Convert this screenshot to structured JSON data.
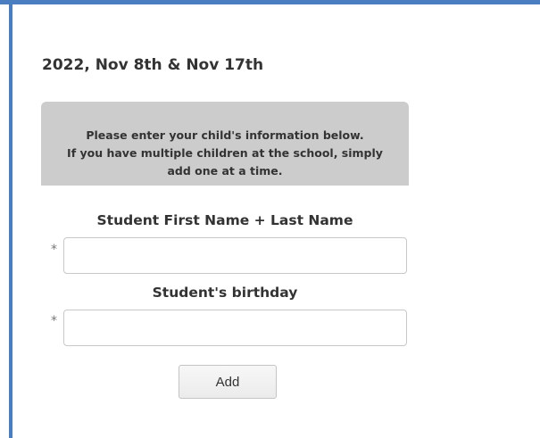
{
  "header": {
    "date_title": "2022, Nov 8th & Nov 17th"
  },
  "notice": {
    "lines": [
      "Please enter your child's information below.",
      "If you have multiple children at the school, simply",
      "add one at a time."
    ]
  },
  "form": {
    "required_marker": "*",
    "student_name": {
      "label": "Student First Name + Last Name",
      "value": ""
    },
    "student_birthday": {
      "label": "Student's birthday",
      "value": ""
    },
    "add_label": "Add"
  },
  "colors": {
    "accent_border": "#4a7ec0",
    "notice_background": "#cccccc"
  }
}
